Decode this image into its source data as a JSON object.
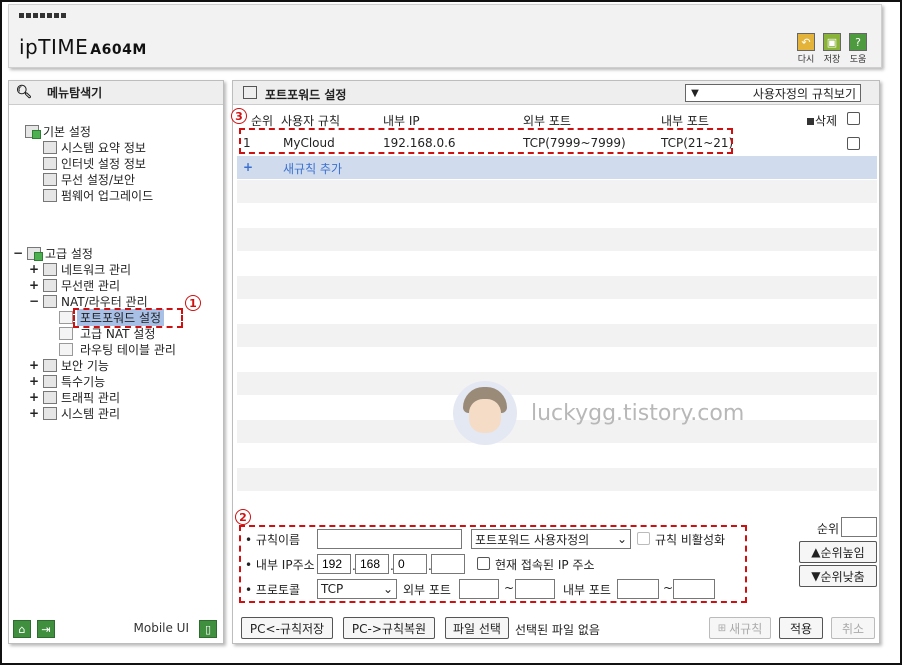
{
  "header": {
    "brand": "ipTIME",
    "model": "A604M",
    "buttons": [
      {
        "label": "다시",
        "icon": "back-icon",
        "color": "#e4b43a"
      },
      {
        "label": "저장",
        "icon": "save-icon",
        "color": "#8ab33a"
      },
      {
        "label": "도움",
        "icon": "help-icon",
        "color": "#4e9a3e"
      }
    ]
  },
  "left_panel": {
    "title": "메뉴탐색기",
    "tree": {
      "basic": {
        "label": "기본 설정",
        "children": [
          "시스템 요약 정보",
          "인터넷 설정 정보",
          "무선 설정/보안",
          "펌웨어 업그레이드"
        ]
      },
      "advanced": {
        "label": "고급 설정",
        "expander": "−"
      },
      "network": {
        "label": "네트워크 관리",
        "expander": "+"
      },
      "wireless": {
        "label": "무선랜 관리",
        "expander": "+"
      },
      "nat": {
        "label": "NAT/라우터 관리",
        "expander": "−",
        "children": [
          "포트포워드 설정",
          "고급 NAT 설정",
          "라우팅 테이블 관리"
        ]
      },
      "security": {
        "label": "보안 기능",
        "expander": "+"
      },
      "special": {
        "label": "특수기능",
        "expander": "+"
      },
      "traffic": {
        "label": "트래픽 관리",
        "expander": "+"
      },
      "system": {
        "label": "시스템 관리",
        "expander": "+"
      }
    },
    "mobile_label": "Mobile UI"
  },
  "annotations": {
    "one": "1",
    "two": "2",
    "three": "3"
  },
  "right_panel": {
    "title": "포트포워드 설정",
    "view_select": "사용자정의 규칙보기",
    "columns": {
      "order": "순위",
      "rule": "사용자 규칙",
      "internal_ip": "내부 IP",
      "external_port": "외부 포트",
      "internal_port": "내부 포트",
      "delete": "삭제"
    },
    "rules": [
      {
        "order": "1",
        "name": "MyCloud",
        "internal_ip": "192.168.0.6",
        "external_port": "TCP(7999~7999)",
        "internal_port": "TCP(21~21)"
      }
    ],
    "add_rule": "새규칙 추가",
    "watermark": "luckygg.tistory.com"
  },
  "form": {
    "rule_name_label": "규칙이름",
    "rule_name_value": "",
    "rule_type_select": "포트포워드 사용자정의",
    "disable_rule_label": "규칙 비활성화",
    "internal_ip_label": "내부 IP주소",
    "ip": [
      "192",
      "168",
      "0",
      ""
    ],
    "current_ip_label": "현재 접속된 IP 주소",
    "protocol_label": "프로토콜",
    "protocol_value": "TCP",
    "external_port_label": "외부 포트",
    "internal_port_label": "내부 포트",
    "tilde": "~",
    "priority_label": "순위",
    "priority_up": "순위높임",
    "priority_down": "순위낮춤"
  },
  "bottom_bar": {
    "save_to_pc": "PC<-규칙저장",
    "restore_from_pc": "PC->규칙복원",
    "file_select": "파일 선택",
    "no_file": "선택된 파일 없음",
    "new_rule": "새규칙",
    "apply": "적용",
    "cancel": "취소"
  }
}
